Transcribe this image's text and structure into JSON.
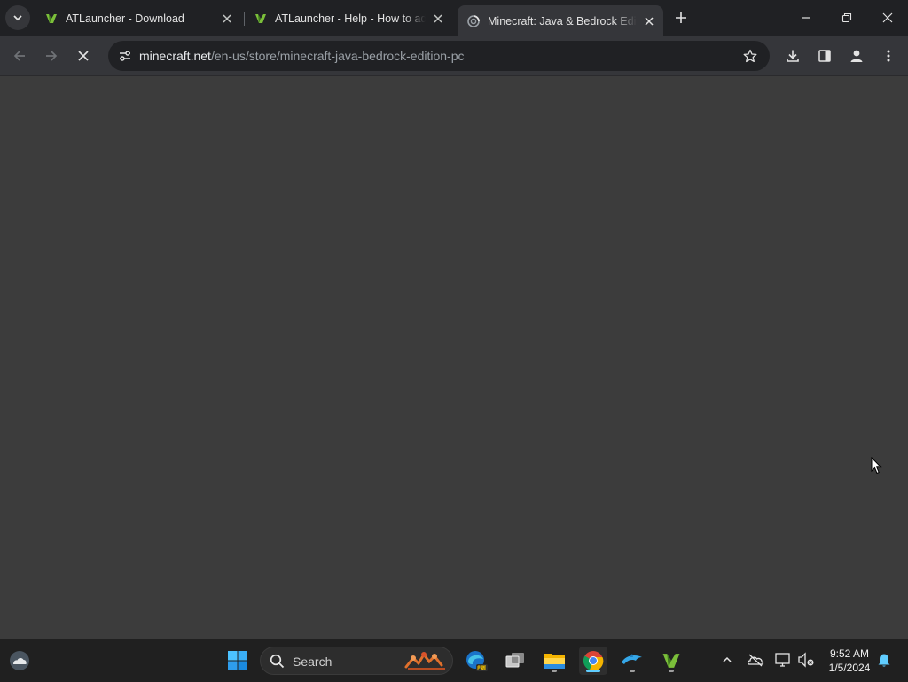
{
  "browser": {
    "tabs": [
      {
        "title": "ATLauncher - Download",
        "favicon": "atlauncher-icon",
        "active": false
      },
      {
        "title": "ATLauncher - Help - How to add",
        "favicon": "atlauncher-icon",
        "active": false
      },
      {
        "title": "Minecraft: Java & Bedrock Edition",
        "favicon": "loading-spinner-icon",
        "active": true
      }
    ],
    "address": {
      "host": "minecraft.net",
      "path": "/en-us/store/minecraft-java-bedrock-edition-pc"
    },
    "loading": true
  },
  "taskbar": {
    "search_label": "Search",
    "clock_time": "9:52 AM",
    "clock_date": "1/5/2024"
  },
  "colors": {
    "accent": "#60cdff",
    "content_bg": "#3c3c3c",
    "titlebar_bg": "#202124",
    "toolbar_bg": "#35363a"
  }
}
